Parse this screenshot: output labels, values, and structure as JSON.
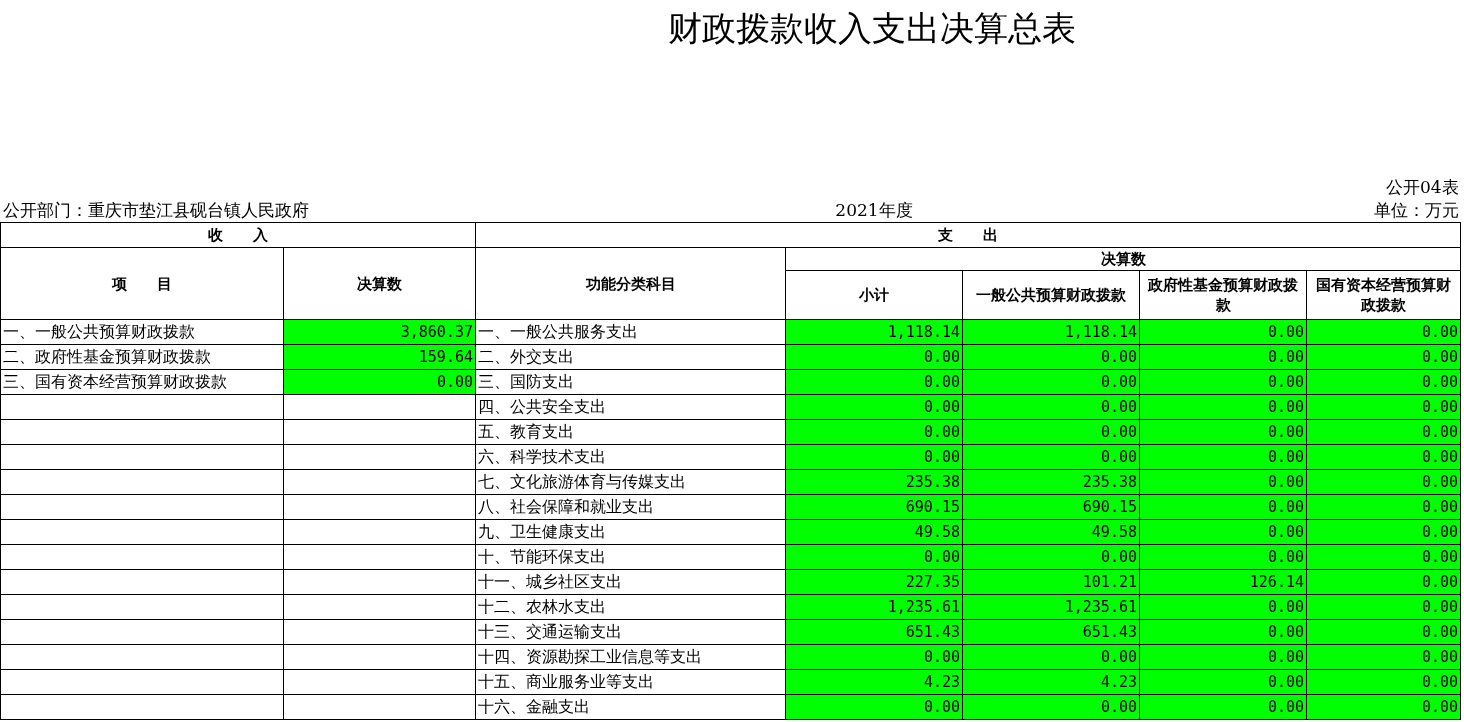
{
  "title": "财政拨款收入支出决算总表",
  "form_code": "公开04表",
  "department": "公开部门：重庆市垫江县砚台镇人民政府",
  "year": "2021年度",
  "unit": "单位：万元",
  "header": {
    "income": "收　　入",
    "expense": "支　　出",
    "income_item": "项　　目",
    "income_amount": "决算数",
    "expense_item": "功能分类科目",
    "expense_amount": "决算数",
    "expense_columns": [
      "小计",
      "一般公共预算财政拨款",
      "政府性基金预算财政拨款",
      "国有资本经营预算财政拨款"
    ]
  },
  "rows": [
    {
      "income": {
        "item": "一、一般公共预算财政拨款",
        "amount": "3,860.37",
        "highlighted": true
      },
      "expense": {
        "item": "一、一般公共服务支出",
        "values": [
          "1,118.14",
          "1,118.14",
          "0.00",
          "0.00"
        ],
        "highlighted": true
      }
    },
    {
      "income": {
        "item": "二、政府性基金预算财政拨款",
        "amount": "159.64",
        "highlighted": true
      },
      "expense": {
        "item": "二、外交支出",
        "values": [
          "0.00",
          "0.00",
          "0.00",
          "0.00"
        ],
        "highlighted": true
      }
    },
    {
      "income": {
        "item": "三、国有资本经营预算财政拨款",
        "amount": "0.00",
        "highlighted": true
      },
      "expense": {
        "item": "三、国防支出",
        "values": [
          "0.00",
          "0.00",
          "0.00",
          "0.00"
        ],
        "highlighted": true
      }
    },
    {
      "expense": {
        "item": "四、公共安全支出",
        "values": [
          "0.00",
          "0.00",
          "0.00",
          "0.00"
        ],
        "highlighted": true
      }
    },
    {
      "expense": {
        "item": "五、教育支出",
        "values": [
          "0.00",
          "0.00",
          "0.00",
          "0.00"
        ],
        "highlighted": true
      }
    },
    {
      "expense": {
        "item": "六、科学技术支出",
        "values": [
          "0.00",
          "0.00",
          "0.00",
          "0.00"
        ],
        "highlighted": true
      }
    },
    {
      "expense": {
        "item": "七、文化旅游体育与传媒支出",
        "values": [
          "235.38",
          "235.38",
          "0.00",
          "0.00"
        ],
        "highlighted": true
      }
    },
    {
      "expense": {
        "item": "八、社会保障和就业支出",
        "values": [
          "690.15",
          "690.15",
          "0.00",
          "0.00"
        ],
        "highlighted": true
      }
    },
    {
      "expense": {
        "item": "九、卫生健康支出",
        "values": [
          "49.58",
          "49.58",
          "0.00",
          "0.00"
        ],
        "highlighted": true
      }
    },
    {
      "expense": {
        "item": "十、节能环保支出",
        "values": [
          "0.00",
          "0.00",
          "0.00",
          "0.00"
        ],
        "highlighted": true
      }
    },
    {
      "expense": {
        "item": "十一、城乡社区支出",
        "values": [
          "227.35",
          "101.21",
          "126.14",
          "0.00"
        ],
        "highlighted": true
      }
    },
    {
      "expense": {
        "item": "十二、农林水支出",
        "values": [
          "1,235.61",
          "1,235.61",
          "0.00",
          "0.00"
        ],
        "highlighted": true
      }
    },
    {
      "expense": {
        "item": "十三、交通运输支出",
        "values": [
          "651.43",
          "651.43",
          "0.00",
          "0.00"
        ],
        "highlighted": true
      }
    },
    {
      "expense": {
        "item": "十四、资源勘探工业信息等支出",
        "values": [
          "0.00",
          "0.00",
          "0.00",
          "0.00"
        ],
        "highlighted": true
      }
    },
    {
      "expense": {
        "item": "十五、商业服务业等支出",
        "values": [
          "4.23",
          "4.23",
          "0.00",
          "0.00"
        ],
        "highlighted": true
      }
    },
    {
      "expense": {
        "item": "十六、金融支出",
        "values": [
          "0.00",
          "0.00",
          "0.00",
          "0.00"
        ],
        "highlighted": true
      }
    }
  ]
}
